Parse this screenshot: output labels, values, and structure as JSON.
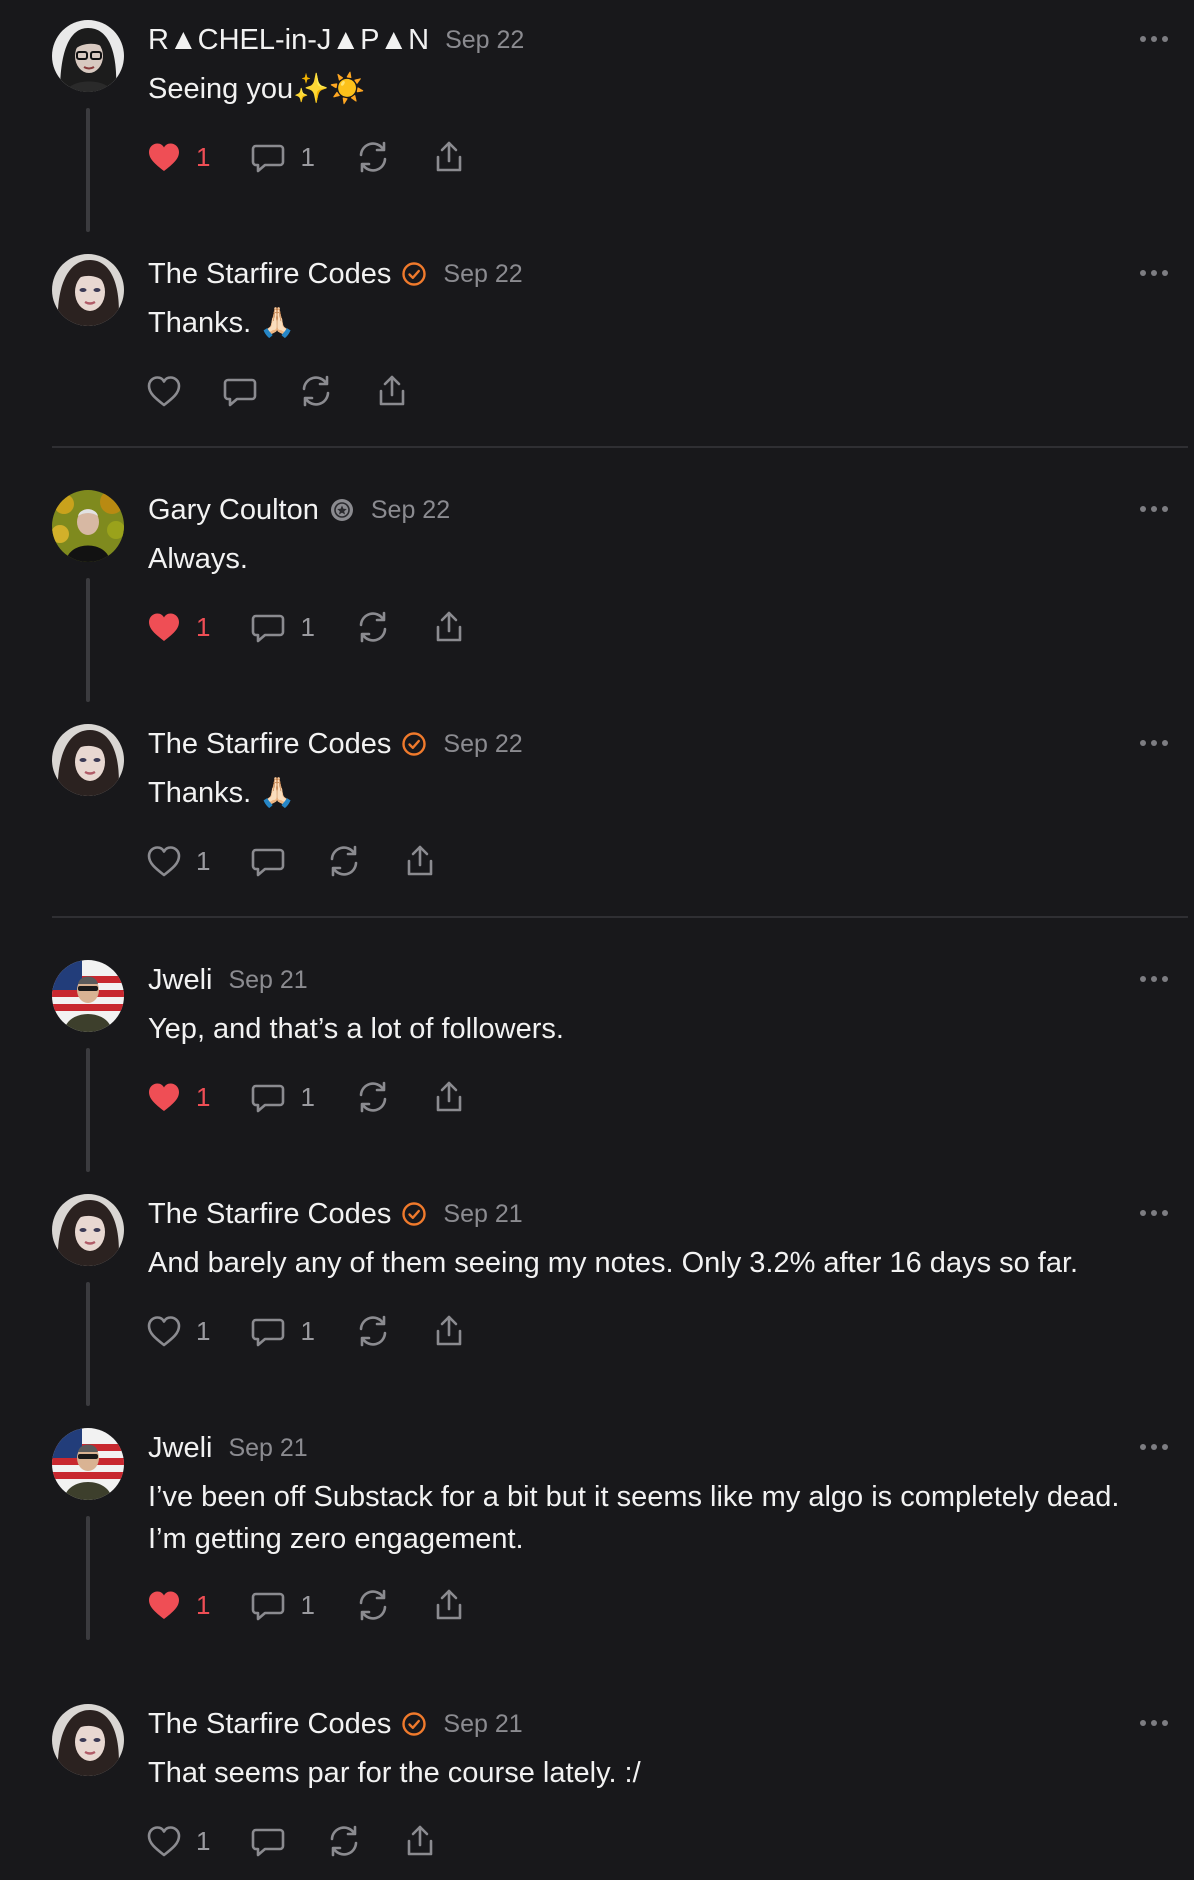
{
  "colors": {
    "background": "#18181b",
    "text": "#f2f2f2",
    "muted": "#8b8b90",
    "like_red": "#ef4e55",
    "verified_orange": "#f07a2c",
    "thread_line": "#3b3b3f"
  },
  "notes": [
    {
      "author": "R▲CHEL-in-J▲P▲N",
      "date": "Sep 22",
      "badge": "none",
      "avatar": "avatar-rachel",
      "text": "Seeing you✨☀️",
      "liked": true,
      "likes": "1",
      "comments": "1",
      "thread": true
    },
    {
      "author": "The Starfire Codes",
      "date": "Sep 22",
      "badge": "verified-icon",
      "avatar": "avatar-starfire",
      "text": "Thanks. 🙏🏻",
      "liked": false,
      "likes": "",
      "comments": "",
      "thread": false
    },
    {
      "author": "Gary Coulton",
      "date": "Sep 22",
      "badge": "subscriber-badge-icon",
      "avatar": "avatar-gary",
      "text": "Always.",
      "liked": true,
      "likes": "1",
      "comments": "1",
      "thread": true
    },
    {
      "author": "The Starfire Codes",
      "date": "Sep 22",
      "badge": "verified-icon",
      "avatar": "avatar-starfire",
      "text": "Thanks. 🙏🏻",
      "liked": false,
      "likes": "1",
      "comments": "",
      "thread": false
    },
    {
      "author": "Jweli",
      "date": "Sep 21",
      "badge": "none",
      "avatar": "avatar-jweli",
      "text": "Yep, and that’s a lot of followers.",
      "liked": true,
      "likes": "1",
      "comments": "1",
      "thread": true
    },
    {
      "author": "The Starfire Codes",
      "date": "Sep 21",
      "badge": "verified-icon",
      "avatar": "avatar-starfire",
      "text": "And barely any of them seeing my notes. Only 3.2% after 16 days so far.",
      "liked": false,
      "likes": "1",
      "comments": "1",
      "thread": true
    },
    {
      "author": "Jweli",
      "date": "Sep 21",
      "badge": "none",
      "avatar": "avatar-jweli",
      "text": "I’ve been off Substack for a bit but it seems like my algo is completely dead. I’m getting zero engagement.",
      "liked": true,
      "likes": "1",
      "comments": "1",
      "thread": true
    },
    {
      "author": "The Starfire Codes",
      "date": "Sep 21",
      "badge": "verified-icon",
      "avatar": "avatar-starfire",
      "text": "That seems par for the course lately. :/",
      "liked": false,
      "likes": "1",
      "comments": "",
      "thread": false
    }
  ]
}
